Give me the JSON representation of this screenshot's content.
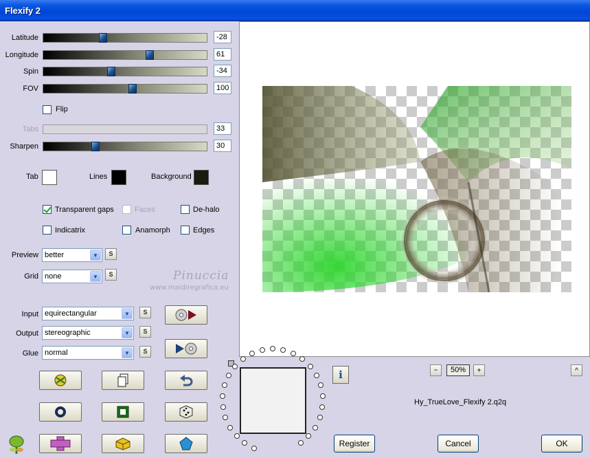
{
  "window": {
    "title": "Flexify 2"
  },
  "sliders": [
    {
      "label": "Latitude",
      "value": "-28",
      "position": 0.36,
      "enabled": true
    },
    {
      "label": "Longitude",
      "value": "61",
      "position": 0.66,
      "enabled": true
    },
    {
      "label": "Spin",
      "value": "-34",
      "position": 0.41,
      "enabled": true
    },
    {
      "label": "FOV",
      "value": "100",
      "position": 0.55,
      "enabled": true
    },
    {
      "label": "Tabs",
      "value": "33",
      "position": 0.0,
      "enabled": false
    },
    {
      "label": "Sharpen",
      "value": "30",
      "position": 0.31,
      "enabled": true
    }
  ],
  "flip": {
    "label": "Flip",
    "checked": false
  },
  "colors": {
    "tab": {
      "label": "Tab",
      "color": "#ffffff"
    },
    "lines": {
      "label": "Lines",
      "color": "#000000"
    },
    "background": {
      "label": "Background",
      "color": "#1a1a10"
    }
  },
  "options": {
    "transparent_gaps": {
      "label": "Transparent gaps",
      "checked": true
    },
    "faces": {
      "label": "Faces",
      "checked": false
    },
    "de_halo": {
      "label": "De-halo",
      "checked": false
    },
    "indicatrix": {
      "label": "Indicatrix",
      "checked": false
    },
    "anamorph": {
      "label": "Anamorph",
      "checked": false
    },
    "edges": {
      "label": "Edges",
      "checked": false
    }
  },
  "preview": {
    "label": "Preview",
    "value": "better",
    "s": "S"
  },
  "grid": {
    "label": "Grid",
    "value": "none",
    "s": "S"
  },
  "input": {
    "label": "Input",
    "value": "equirectangular",
    "s": "S"
  },
  "output": {
    "label": "Output",
    "value": "stereographic",
    "s": "S"
  },
  "glue": {
    "label": "Glue",
    "value": "normal",
    "s": "S"
  },
  "watermark": {
    "line1": "Pinuccia",
    "line2": "www.maidiregrafica.eu"
  },
  "zoom": {
    "minus": "−",
    "value": "50%",
    "plus": "+",
    "up": "^"
  },
  "info_icon": "i",
  "filename": "Hy_TrueLove_Flexify 2.q2q",
  "buttons": {
    "register": "Register",
    "cancel": "Cancel",
    "ok": "OK"
  }
}
